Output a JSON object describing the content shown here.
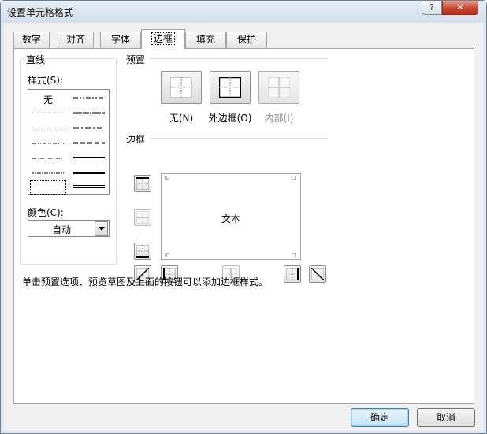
{
  "window": {
    "title": "设置单元格格式",
    "help_label": "?",
    "close_label": "✕"
  },
  "tabs": [
    {
      "label": "数字",
      "active": false
    },
    {
      "label": "对齐",
      "active": false
    },
    {
      "label": "字体",
      "active": false
    },
    {
      "label": "边框",
      "active": true
    },
    {
      "label": "填充",
      "active": false
    },
    {
      "label": "保护",
      "active": false
    }
  ],
  "line_group": {
    "title": "直线",
    "style_label": "样式(S):",
    "none_label": "无",
    "color_label": "颜色(C):",
    "color_value": "自动"
  },
  "presets": {
    "title": "预置",
    "items": [
      {
        "label": "无(N)",
        "enabled": true,
        "icon": "border-none-icon"
      },
      {
        "label": "外边框(O)",
        "enabled": true,
        "icon": "border-outline-icon"
      },
      {
        "label": "内部(I)",
        "enabled": false,
        "icon": "border-inside-icon"
      }
    ]
  },
  "border": {
    "title": "边框",
    "preview_text": "文本"
  },
  "hint": "单击预置选项、预览草图及上面的按钮可以添加边框样式。",
  "buttons": {
    "ok": "确定",
    "cancel": "取消"
  },
  "colors": {
    "panel_border": "#a5a5a5",
    "default_button": "#3c7fb1",
    "disabled_text": "#8d8d8d"
  }
}
